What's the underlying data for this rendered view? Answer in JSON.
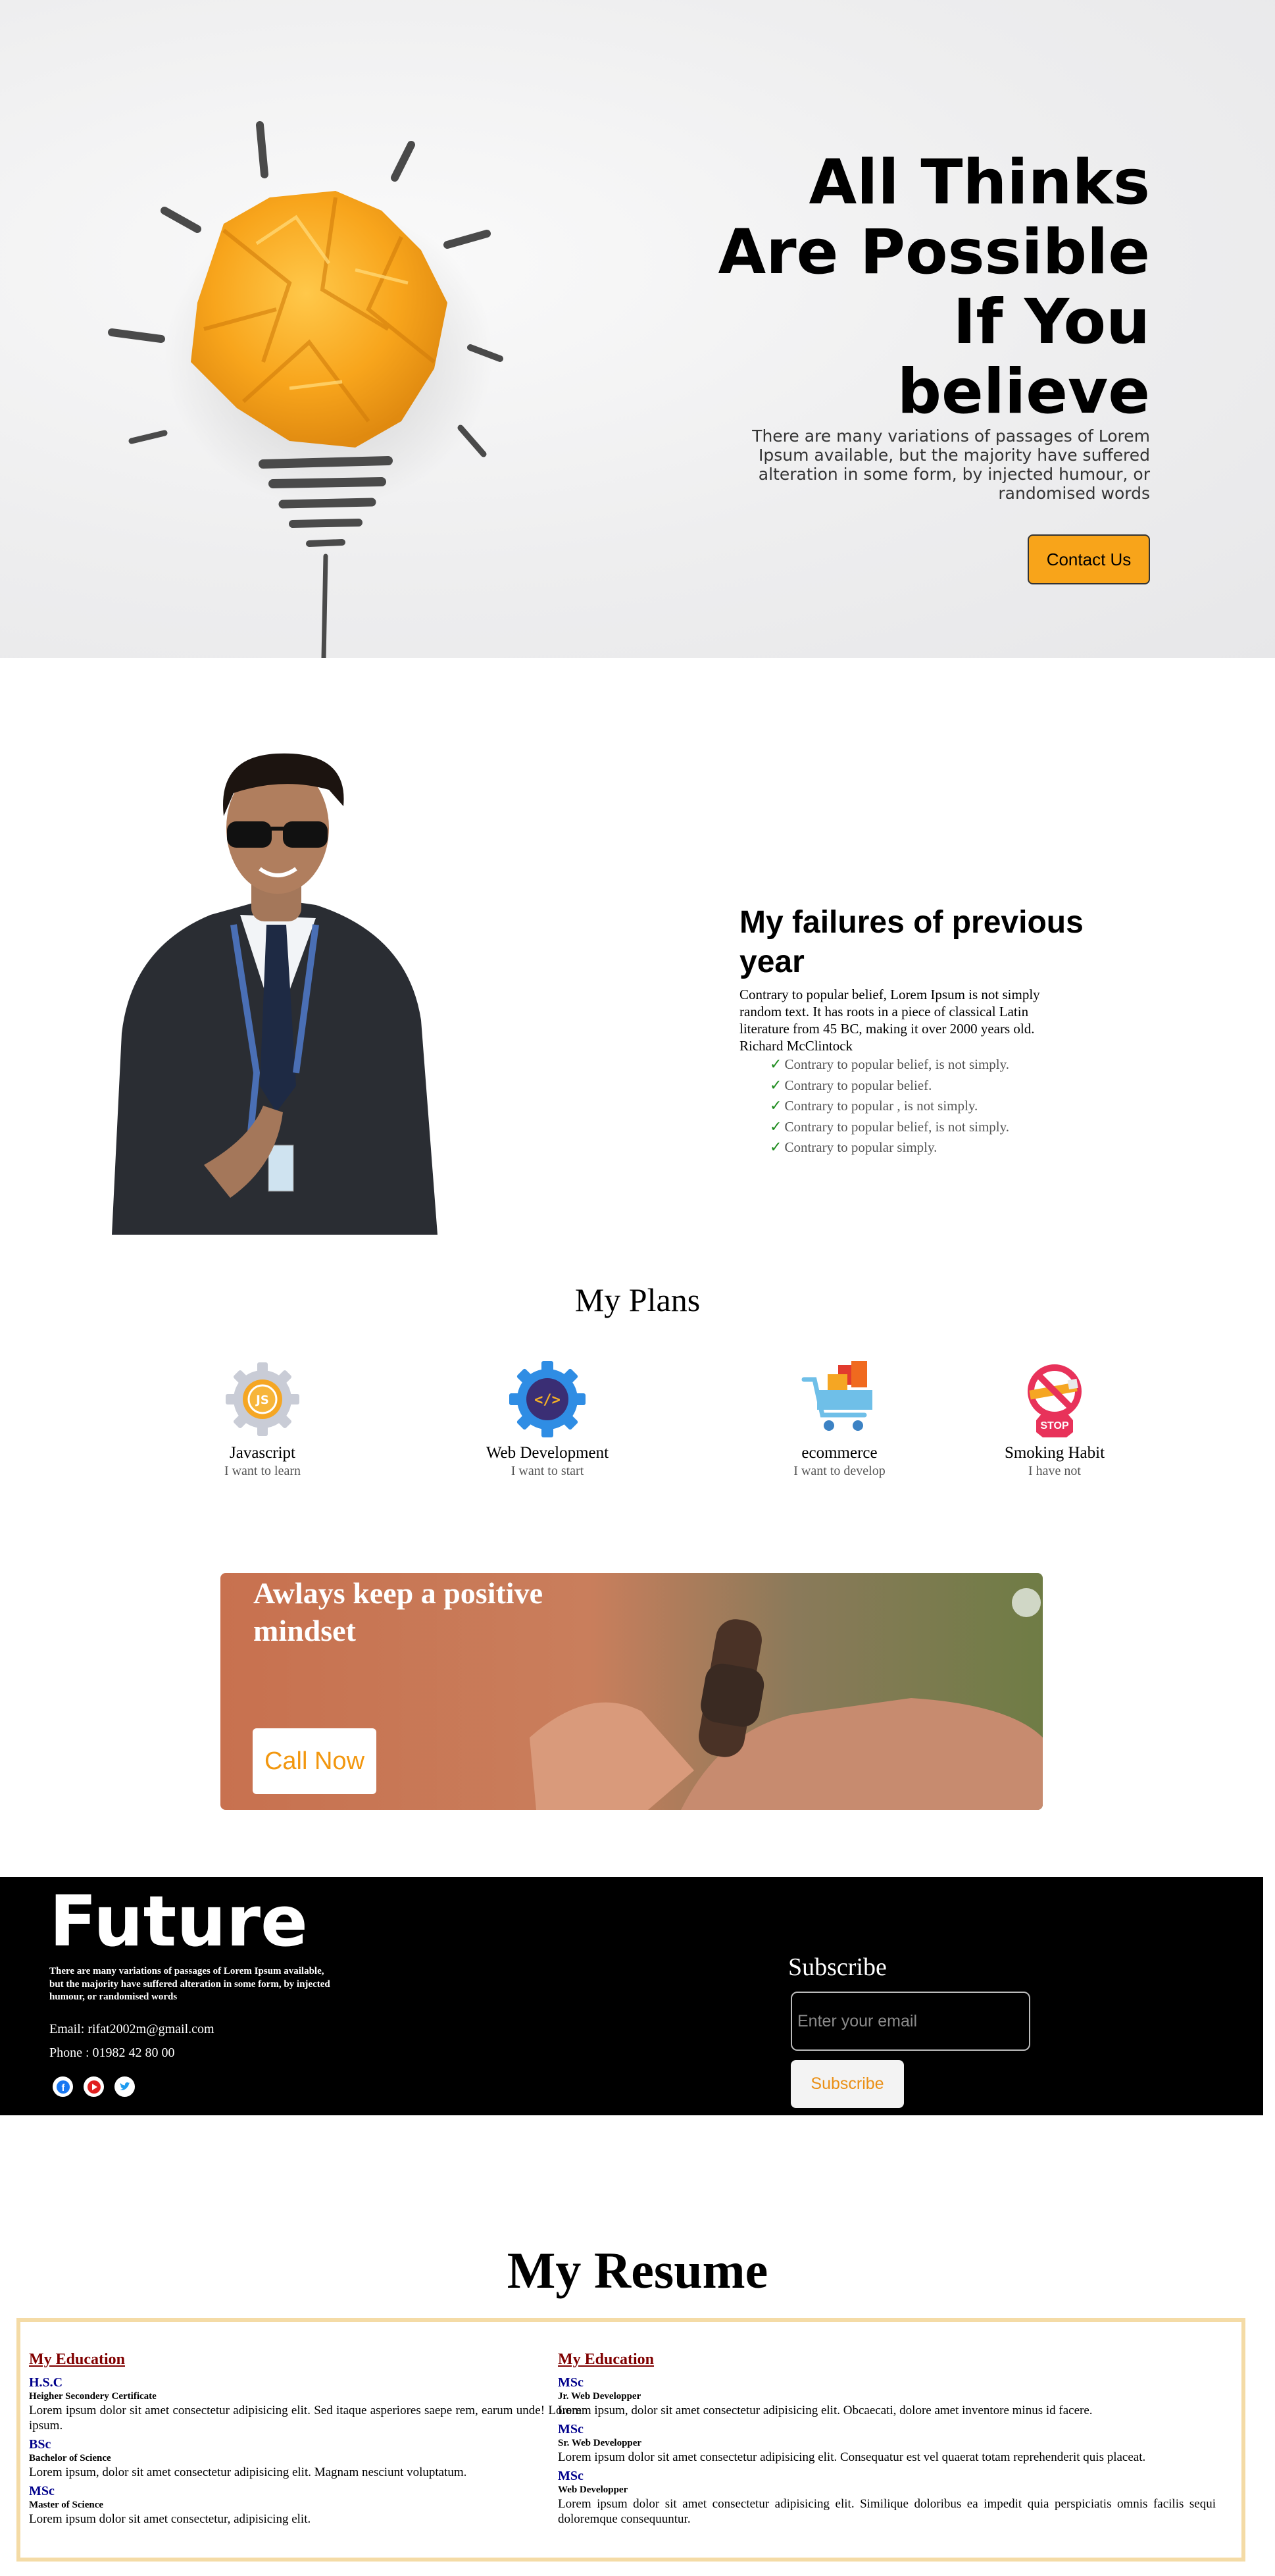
{
  "hero": {
    "title_lines": [
      "All Thinks",
      "Are Possible",
      "If You",
      "believe"
    ],
    "description": "There are many variations of passages of Lorem Ipsum available, but the majority have suffered alteration in some form, by injected humour, or randomised words",
    "cta_label": "Contact Us",
    "accent_color": "#f8a41a"
  },
  "failures": {
    "title": "My failures of previous year",
    "text": "Contrary to popular belief, Lorem Ipsum is not simply random text. It has roots in a piece of classical Latin literature from 45 BC, making it over 2000 years old. Richard McClintock",
    "items": [
      "Contrary to popular belief, is not simply.",
      "Contrary to popular belief.",
      "Contrary to popular , is not simply.",
      "Contrary to popular belief, is not simply.",
      "Contrary to popular simply."
    ],
    "check_icon": "check-icon"
  },
  "plans": {
    "title": "My Plans",
    "items": [
      {
        "name": "Javascript",
        "desc": "I want to learn",
        "icon": "javascript-gear-icon"
      },
      {
        "name": "Web Development",
        "desc": "I want to start",
        "icon": "code-gear-icon"
      },
      {
        "name": "ecommerce",
        "desc": "I want to develop",
        "icon": "shopping-cart-icon"
      },
      {
        "name": "Smoking Habit",
        "desc": "I have not",
        "icon": "no-smoking-icon"
      }
    ]
  },
  "banner": {
    "title": "Awlays keep a positive mindset",
    "cta_label": "Call Now"
  },
  "footer": {
    "brand": "Future",
    "description": "There are many variations of passages of Lorem Ipsum available, but the majority have suffered alteration in some form, by injected humour, or randomised words",
    "email": "Email: rifat2002m@gmail.com",
    "phone": "Phone : 01982 42 80 00",
    "socials": [
      "facebook-icon",
      "youtube-icon",
      "twitter-icon"
    ],
    "subscribe_title": "Subscribe",
    "email_placeholder": "Enter your email",
    "subscribe_label": "Subscribe"
  },
  "resume": {
    "title": "My Resume",
    "left": {
      "heading": "My Education",
      "entries": [
        {
          "degree": "H.S.C",
          "sub": "Heigher Secondery Certificate",
          "text": "Lorem ipsum dolor sit amet consectetur adipisicing elit. Sed itaque asperiores saepe rem, earum unde! Lorem ipsum."
        },
        {
          "degree": "BSc",
          "sub": "Bachelor of Science",
          "text": "Lorem ipsum, dolor sit amet consectetur adipisicing elit. Magnam nesciunt voluptatum."
        },
        {
          "degree": "MSc",
          "sub": "Master of Science",
          "text": "Lorem ipsum dolor sit amet consectetur, adipisicing elit."
        }
      ]
    },
    "right": {
      "heading": "My Education",
      "entries": [
        {
          "degree": "MSc",
          "sub": "Jr. Web Developper",
          "text": "Lorem ipsum, dolor sit amet consectetur adipisicing elit. Obcaecati, dolore amet inventore minus id facere."
        },
        {
          "degree": "MSc",
          "sub": "Sr. Web Developper",
          "text": "Lorem ipsum dolor sit amet consectetur adipisicing elit. Consequatur est vel quaerat totam reprehenderit quis placeat."
        },
        {
          "degree": "MSc",
          "sub": "Web Developper",
          "text": "Lorem ipsum dolor sit amet consectetur adipisicing elit. Similique doloribus ea impedit quia perspiciatis omnis facilis sequi doloremque consequuntur."
        }
      ]
    }
  }
}
